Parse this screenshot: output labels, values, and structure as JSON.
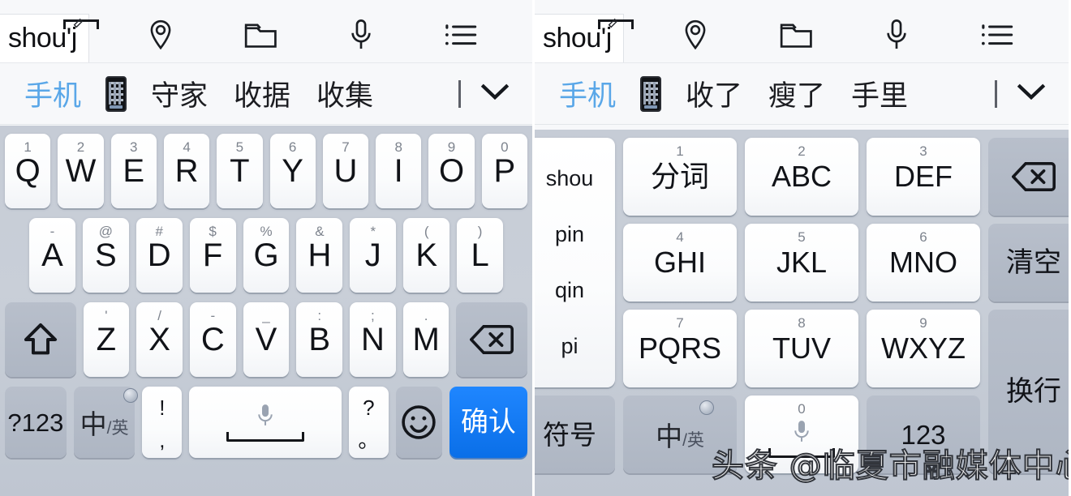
{
  "left_panel": {
    "input": {
      "text": "shou'j",
      "pencil_icon": "pencil-icon"
    },
    "toolbar_icons": [
      "location-pin-icon",
      "folder-icon",
      "microphone-icon",
      "list-icon"
    ],
    "candidates": {
      "selected": "手机",
      "emoji": "phone-emoji",
      "items": [
        "守家",
        "收据",
        "收集"
      ],
      "expand": "chevron-down-icon"
    },
    "keyboard": {
      "type": "qwerty",
      "row1": [
        {
          "sup": "1",
          "main": "Q"
        },
        {
          "sup": "2",
          "main": "W"
        },
        {
          "sup": "3",
          "main": "E"
        },
        {
          "sup": "4",
          "main": "R"
        },
        {
          "sup": "5",
          "main": "T"
        },
        {
          "sup": "6",
          "main": "Y"
        },
        {
          "sup": "7",
          "main": "U"
        },
        {
          "sup": "8",
          "main": "I"
        },
        {
          "sup": "9",
          "main": "O"
        },
        {
          "sup": "0",
          "main": "P"
        }
      ],
      "row2": [
        {
          "sup": "-",
          "main": "A"
        },
        {
          "sup": "@",
          "main": "S"
        },
        {
          "sup": "#",
          "main": "D"
        },
        {
          "sup": "$",
          "main": "F"
        },
        {
          "sup": "%",
          "main": "G"
        },
        {
          "sup": "&",
          "main": "H"
        },
        {
          "sup": "*",
          "main": "J"
        },
        {
          "sup": "(",
          "main": "K"
        },
        {
          "sup": ")",
          "main": "L"
        }
      ],
      "row3": [
        {
          "sup": "'",
          "main": "Z"
        },
        {
          "sup": "/",
          "main": "X"
        },
        {
          "sup": "-",
          "main": "C"
        },
        {
          "sup": "_",
          "main": "V"
        },
        {
          "sup": ":",
          "main": "B"
        },
        {
          "sup": ";",
          "main": "N"
        },
        {
          "sup": ".",
          "main": "M"
        }
      ],
      "shift": "shift-icon",
      "backspace": "backspace-icon",
      "row4": {
        "numbers": "?123",
        "lang_cn": "中",
        "lang_en": "/英",
        "punct_top": "!",
        "punct_bottom": ",",
        "space_label": "",
        "punct2_top": "?",
        "punct2_bottom": "。",
        "emoji": "smiley-icon",
        "enter": "确认"
      }
    }
  },
  "right_panel": {
    "input": {
      "text": "shou'j",
      "pencil_icon": "pencil-icon"
    },
    "toolbar_icons": [
      "location-pin-icon",
      "folder-icon",
      "microphone-icon",
      "list-icon"
    ],
    "candidates": {
      "selected": "手机",
      "emoji": "phone-emoji",
      "items": [
        "收了",
        "瘦了",
        "手里"
      ],
      "expand": "chevron-down-icon"
    },
    "keyboard": {
      "type": "t9",
      "pinyin_column": [
        "shou",
        "pin",
        "qin",
        "pi"
      ],
      "row1": [
        {
          "sup": "1",
          "main": "分词"
        },
        {
          "sup": "2",
          "main": "ABC"
        },
        {
          "sup": "3",
          "main": "DEF"
        }
      ],
      "row2": [
        {
          "sup": "4",
          "main": "GHI"
        },
        {
          "sup": "5",
          "main": "JKL"
        },
        {
          "sup": "6",
          "main": "MNO"
        }
      ],
      "row3": [
        {
          "sup": "7",
          "main": "PQRS"
        },
        {
          "sup": "8",
          "main": "TUV"
        },
        {
          "sup": "9",
          "main": "WXYZ"
        }
      ],
      "row4": {
        "symbols": "符号",
        "lang_cn": "中",
        "lang_en": "/英",
        "space_sup": "0",
        "numbers": "123"
      },
      "backspace": "backspace-icon",
      "clear": "清空",
      "newline": "换行"
    }
  },
  "watermark": {
    "text": "头条 @临夏市融媒体中心"
  },
  "colors": {
    "accent_blue": "#1f86ff",
    "candidate_selected": "#5aa7e8",
    "key_white": "#ffffff",
    "key_grey": "#b4bcc8",
    "keyboard_bg": "#c6ccd6"
  }
}
